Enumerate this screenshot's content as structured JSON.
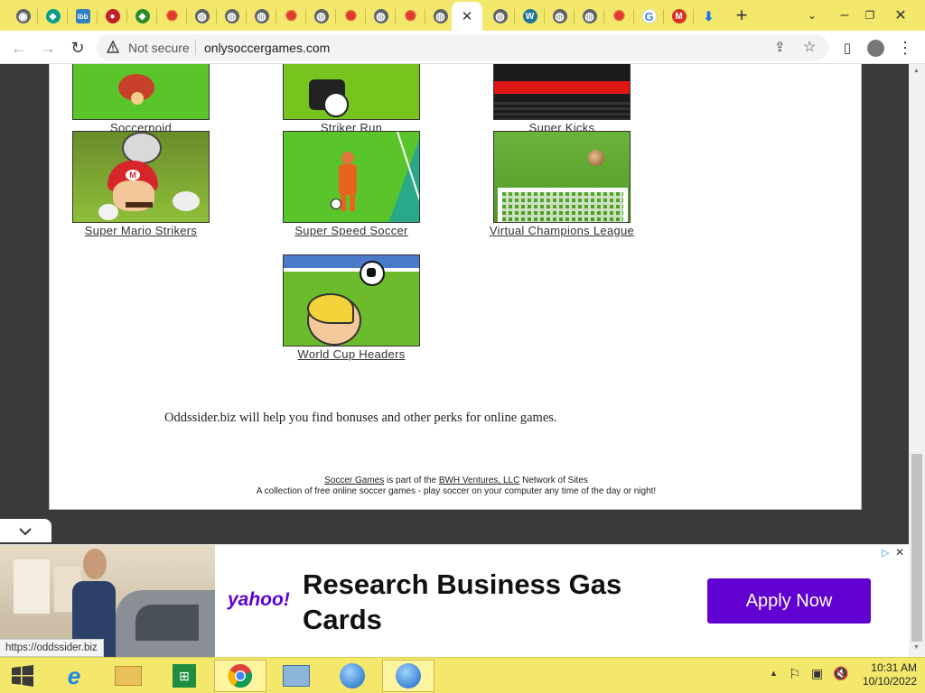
{
  "browser": {
    "tabs": [
      {
        "icon": "chrome-icon",
        "color": "#5f6368",
        "glyph": "◉"
      },
      {
        "icon": "teal-leaf-icon",
        "color": "#0a9d8a",
        "glyph": "◆"
      },
      {
        "icon": "ibb-icon",
        "color": "#2f7fc1",
        "glyph": "ibb"
      },
      {
        "icon": "mushroom-icon",
        "color": "#c0202a",
        "glyph": "●"
      },
      {
        "icon": "green-ticket-icon",
        "color": "#2c8a2c",
        "glyph": "◆"
      },
      {
        "icon": "red-flower-icon",
        "color": "#e03a2e",
        "glyph": "✺"
      },
      {
        "icon": "globe-icon",
        "color": "#5f6368",
        "glyph": "◍"
      },
      {
        "icon": "globe-icon",
        "color": "#5f6368",
        "glyph": "◍"
      },
      {
        "icon": "globe-icon",
        "color": "#5f6368",
        "glyph": "◍"
      },
      {
        "icon": "red-flower-icon",
        "color": "#e03a2e",
        "glyph": "✺"
      },
      {
        "icon": "globe-icon",
        "color": "#5f6368",
        "glyph": "◍"
      },
      {
        "icon": "red-flower-icon",
        "color": "#e03a2e",
        "glyph": "✺"
      },
      {
        "icon": "globe-icon",
        "color": "#5f6368",
        "glyph": "◍"
      },
      {
        "icon": "red-flower-icon",
        "color": "#e03a2e",
        "glyph": "✺"
      },
      {
        "icon": "globe-icon",
        "color": "#5f6368",
        "glyph": "◍"
      },
      {
        "icon": "close-icon",
        "color": "#333333",
        "glyph": "✕",
        "active": true
      },
      {
        "icon": "globe-icon",
        "color": "#5f6368",
        "glyph": "◍"
      },
      {
        "icon": "wordpress-icon",
        "color": "#21759b",
        "glyph": "W"
      },
      {
        "icon": "globe-icon",
        "color": "#5f6368",
        "glyph": "◍"
      },
      {
        "icon": "globe-icon",
        "color": "#5f6368",
        "glyph": "◍"
      },
      {
        "icon": "red-flower-icon",
        "color": "#e03a2e",
        "glyph": "✺"
      },
      {
        "icon": "google-icon",
        "color": "#4285f4",
        "glyph": "G"
      },
      {
        "icon": "gmail-icon",
        "color": "#d93025",
        "glyph": "M"
      },
      {
        "icon": "download-icon",
        "color": "#1a73e8",
        "glyph": "⬇"
      }
    ],
    "security_label": "Not secure",
    "url": "onlysoccergames.com"
  },
  "page": {
    "games": [
      {
        "name": "Soccernoid",
        "theme": "partial-green"
      },
      {
        "name": "Striker Run",
        "theme": "partial-ball"
      },
      {
        "name": "Super Kicks",
        "theme": "partial-dark"
      },
      {
        "name": "Super Mario Strikers",
        "theme": "mario"
      },
      {
        "name": "Super Speed Soccer",
        "theme": "speed"
      },
      {
        "name": "Virtual Champions League",
        "theme": "goal"
      },
      {
        "name": "World Cup Headers",
        "theme": "headers"
      }
    ],
    "promo_text": "Oddssider.biz will help you find bonuses and other perks for online games.",
    "footer": {
      "link1": "Soccer Games",
      "middle": " is part of the ",
      "link2": "BWH Ventures, LLC",
      "end": " Network of Sites",
      "line2": "A collection of free online soccer games - play soccer on your computer any time of the day or night!"
    }
  },
  "ad": {
    "brand": "yahoo!",
    "headline": "Research Business Gas Cards",
    "cta": "Apply Now",
    "cta_color": "#6001d2"
  },
  "status_url": "https://oddssider.biz",
  "taskbar": {
    "time": "10:31 AM",
    "date": "10/10/2022"
  }
}
